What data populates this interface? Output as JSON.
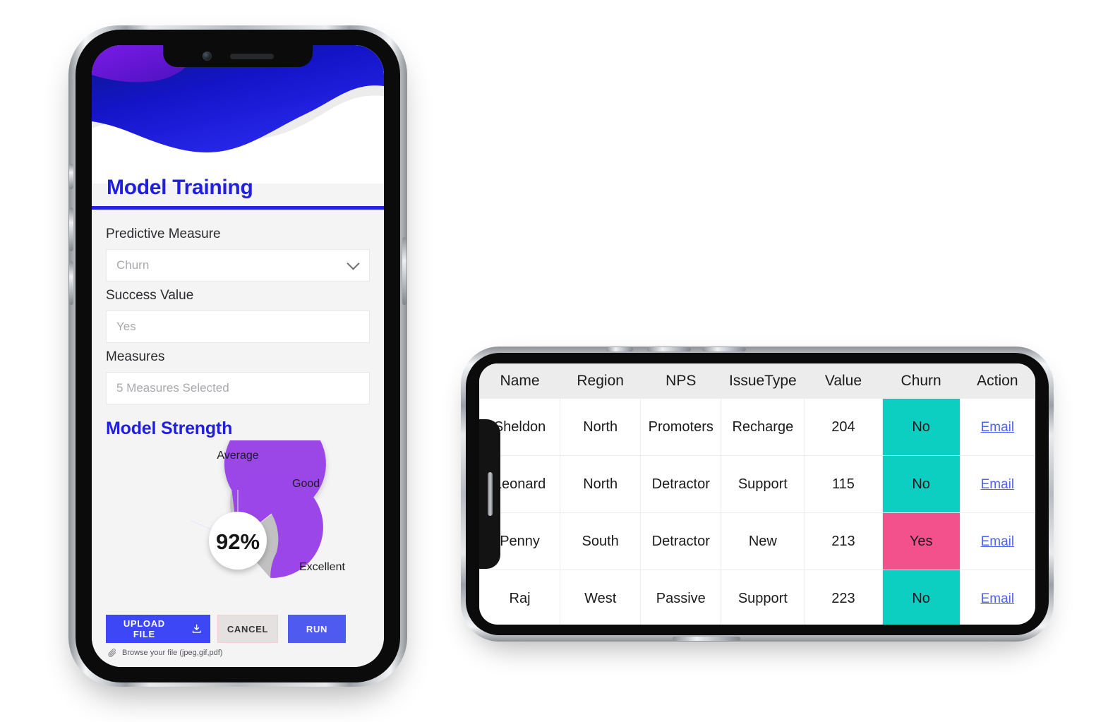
{
  "phone1": {
    "app_title": "Model Training",
    "fields": [
      {
        "label": "Predictive Measure",
        "value": "Churn",
        "type": "select",
        "icon": "chevron-down-icon"
      },
      {
        "label": "Success Value",
        "value": "Yes",
        "type": "text",
        "icon": ""
      },
      {
        "label": "Measures",
        "value": "5 Measures Selected",
        "type": "text",
        "icon": ""
      }
    ],
    "strength_title": "Model Strength",
    "buttons": {
      "upload": "UPLOAD FILE",
      "upload_icon": "download-icon",
      "cancel": "CANCEL",
      "run": "RUN"
    },
    "browse_hint": "Browse your file (jpeg,gif,pdf)",
    "browse_icon": "paperclip-icon",
    "colors": {
      "brand_blue": "#1f1fdd",
      "banner_navy": "#0d1f8f",
      "banner_blue": "#2323e3",
      "banner_purple": "#6a18dd",
      "upload_btn": "#3d47f5",
      "run_btn": "#4e5af0",
      "cancel_btn": "#e6e1e1",
      "donut_purple": "#9b46e8",
      "donut_gray": "#c1c1c1"
    },
    "chart_data": {
      "type": "pie",
      "title": "Model Strength",
      "center_label": "92%",
      "categories": [
        "Average",
        "Good",
        "Excellent"
      ],
      "values": [
        62,
        14,
        24
      ],
      "colors": [
        "#9b46e8",
        "#9b46e8",
        "#c1c1c1"
      ],
      "labels": [
        "Average",
        "Good",
        "Excellent"
      ],
      "legend": "callout-labels",
      "donut_hole": 0.55
    }
  },
  "phone2": {
    "table": {
      "columns": [
        "Name",
        "Region",
        "NPS",
        "IssueType",
        "Value",
        "Churn",
        "Action"
      ],
      "rows": [
        {
          "name": "Sheldon",
          "region": "North",
          "nps": "Promoters",
          "issue_type": "Recharge",
          "value": "204",
          "churn": "No",
          "action": "Email"
        },
        {
          "name": "Leonard",
          "region": "North",
          "nps": "Detractor",
          "issue_type": "Support",
          "value": "115",
          "churn": "No",
          "action": "Email"
        },
        {
          "name": "Penny",
          "region": "South",
          "nps": "Detractor",
          "issue_type": "New",
          "value": "213",
          "churn": "Yes",
          "action": "Email"
        },
        {
          "name": "Raj",
          "region": "West",
          "nps": "Passive",
          "issue_type": "Support",
          "value": "223",
          "churn": "No",
          "action": "Email"
        }
      ],
      "churn_colors": {
        "No": "#0ccfc2",
        "Yes": "#f2518b"
      },
      "link_color": "#4f63f3"
    }
  }
}
